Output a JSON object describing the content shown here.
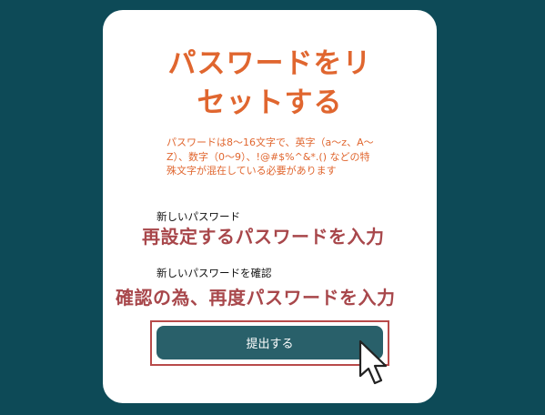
{
  "card": {
    "title_line1": "パスワードをリ",
    "title_line2": "セットする",
    "requirement_note": "パスワードは8～16文字で、英字（a～z、A～Z）、数字（0～9）、!@#$%^&*.() などの特殊文字が混在している必要があります"
  },
  "fields": {
    "new_password_label": "新しいパスワード",
    "confirm_password_label": "新しいパスワードを確認"
  },
  "annotations": {
    "new_password_hint": "再設定するパスワードを入力",
    "confirm_password_hint": "確認の為、再度パスワードを入力"
  },
  "submit": {
    "label": "提出する"
  },
  "colors": {
    "background": "#0d4a57",
    "accent": "#e0662f",
    "annotation": "#a8474b",
    "button": "#29606a"
  },
  "icons": {
    "cursor": "mouse-pointer-icon"
  }
}
